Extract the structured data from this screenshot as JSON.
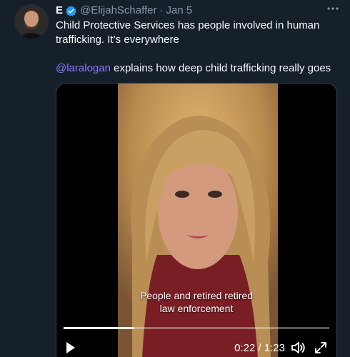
{
  "tweet": {
    "display_name": "E",
    "handle": "@ElijahSchaffer",
    "dot": "·",
    "date": "Jan 5",
    "more_label": "•••",
    "text_line1": "Child Protective Services has people involved in human trafficking. It’s everywhere",
    "mention": "@laralogan",
    "text_line2_rest": " explains how deep child trafficking really goes"
  },
  "video": {
    "subtitle_line1": "People and retired retired",
    "subtitle_line2": "law enforcement",
    "time": "0:22 / 1:23",
    "progress_fraction": 0.265
  },
  "colors": {
    "background": "#15202b",
    "secondary_text": "#8b98a5",
    "mention": "#8b7cf6",
    "verified": "#1d9bf0"
  },
  "icons": [
    "verified-badge-icon",
    "more-icon",
    "play-icon",
    "volume-icon",
    "fullscreen-icon"
  ]
}
